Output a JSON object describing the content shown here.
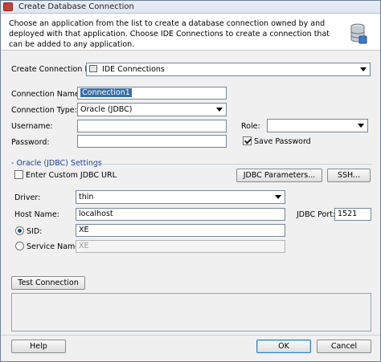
{
  "window": {
    "title": "Create Database Connection"
  },
  "description": "Choose an application from the list to create a database connection owned by and deployed with that application. Choose IDE Connections to create a connection that can be added to any application.",
  "form": {
    "create_in_label": "Create Connection In:",
    "create_in_value": "IDE Connections",
    "connection_name_label": "Connection Name:",
    "connection_name_value": "Connection1",
    "connection_type_label": "Connection Type:",
    "connection_type_value": "Oracle (JDBC)",
    "username_label": "Username:",
    "username_value": "",
    "password_label": "Password:",
    "password_value": "",
    "role_label": "Role:",
    "role_value": "",
    "save_password_label": "Save Password",
    "save_password_checked": true
  },
  "oracle": {
    "section_label": "- Oracle (JDBC) Settings",
    "custom_url_label": "Enter Custom JDBC URL",
    "jdbc_params_label": "JDBC Parameters...",
    "ssh_label": "SSH...",
    "driver_label": "Driver:",
    "driver_value": "thin",
    "host_label": "Host Name:",
    "host_value": "localhost",
    "port_label": "JDBC Port:",
    "port_value": "1521",
    "sid_label": "SID:",
    "sid_value": "XE",
    "service_label": "Service Name:",
    "service_value": "XE"
  },
  "buttons": {
    "test_connection": "Test Connection",
    "help": "Help",
    "ok": "OK",
    "cancel": "Cancel"
  },
  "colors": {
    "selection": "#3a6ea5",
    "section_text": "#1c3f94"
  }
}
